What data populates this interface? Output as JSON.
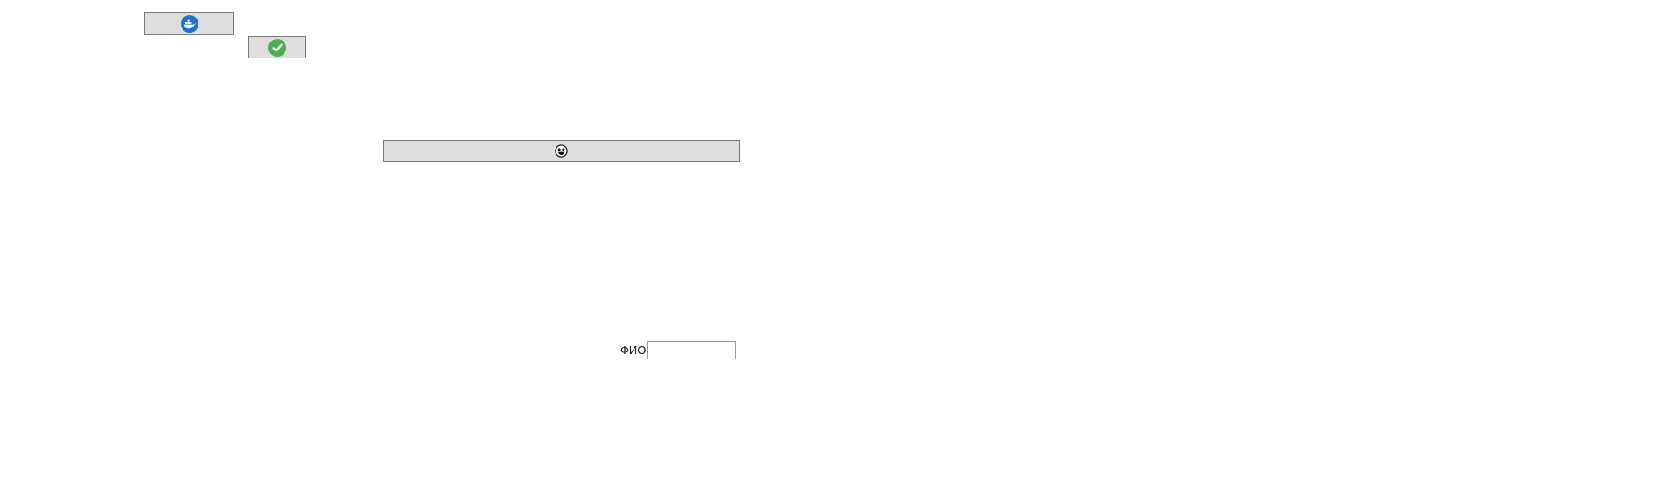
{
  "buttons": {
    "docker": {
      "icon": "docker-whale-icon",
      "color": "#1d6fd1"
    },
    "confirm": {
      "icon": "green-checkmark-icon",
      "color": "#4cb050"
    },
    "wide": {
      "icon": "smiley-emoji-icon",
      "color": "#111111"
    }
  },
  "form": {
    "fio_label": "ФИО",
    "fio_value": "",
    "fio_placeholder": ""
  }
}
